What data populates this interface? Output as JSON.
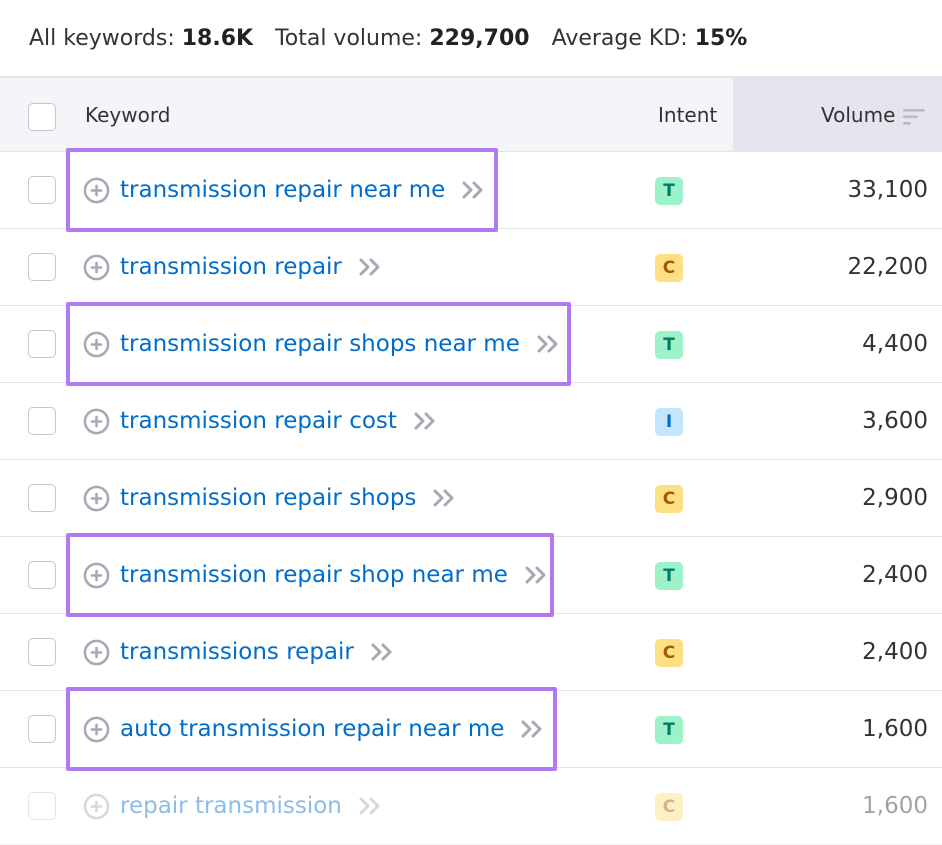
{
  "summary": {
    "all_keywords_label": "All keywords:",
    "all_keywords_value": "18.6K",
    "total_volume_label": "Total volume:",
    "total_volume_value": "229,700",
    "avg_kd_label": "Average KD:",
    "avg_kd_value": "15%"
  },
  "table": {
    "headers": {
      "keyword": "Keyword",
      "intent": "Intent",
      "volume": "Volume"
    },
    "rows": [
      {
        "keyword": "transmission repair near me",
        "intent": "T",
        "volume": "33,100",
        "highlighted": true
      },
      {
        "keyword": "transmission repair",
        "intent": "C",
        "volume": "22,200",
        "highlighted": false
      },
      {
        "keyword": "transmission repair shops near me",
        "intent": "T",
        "volume": "4,400",
        "highlighted": true
      },
      {
        "keyword": "transmission repair cost",
        "intent": "I",
        "volume": "3,600",
        "highlighted": false
      },
      {
        "keyword": "transmission repair shops",
        "intent": "C",
        "volume": "2,900",
        "highlighted": false
      },
      {
        "keyword": "transmission repair shop near me",
        "intent": "T",
        "volume": "2,400",
        "highlighted": true
      },
      {
        "keyword": "transmissions repair",
        "intent": "C",
        "volume": "2,400",
        "highlighted": false
      },
      {
        "keyword": "auto transmission repair near me",
        "intent": "T",
        "volume": "1,600",
        "highlighted": true
      },
      {
        "keyword": "repair transmission",
        "intent": "C",
        "volume": "1,600",
        "highlighted": false
      }
    ]
  },
  "colors": {
    "link": "#006dca",
    "highlight_border": "#b07bf0",
    "intent_T_bg": "#9ef2c9",
    "intent_C_bg": "#fce081",
    "intent_I_bg": "#c4e5fe"
  },
  "icons": {
    "add": "plus-circle-icon",
    "more": "chevron-double-right-icon",
    "sort": "sort-descending-icon"
  }
}
